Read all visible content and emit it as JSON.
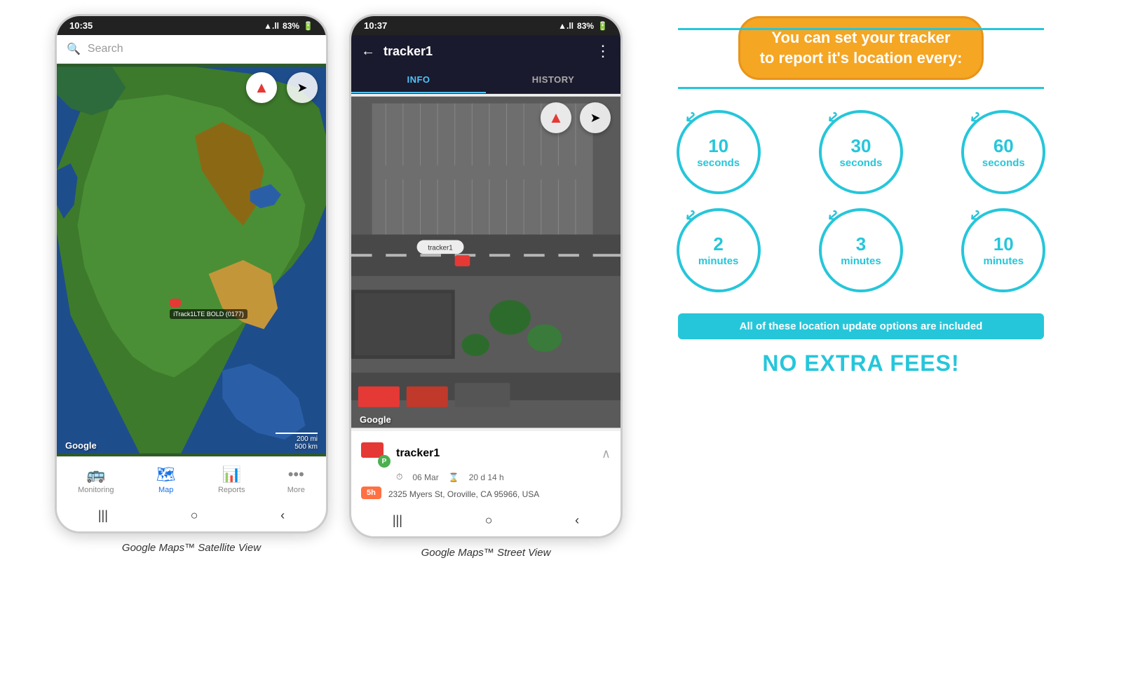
{
  "phone1": {
    "status_time": "10:35",
    "status_signal": "▲.ll",
    "status_battery": "83%",
    "search_placeholder": "Search",
    "compass1_symbol": "↑",
    "compass2_symbol": "➤",
    "tracker_label": "iTrack1LTE BOLD (0177)",
    "google_logo": "Google",
    "map_scale1": "200 mi",
    "map_scale2": "500 km",
    "nav_items": [
      {
        "label": "Monitoring",
        "icon": "🚌",
        "active": false
      },
      {
        "label": "Map",
        "icon": "🗺",
        "active": true
      },
      {
        "label": "Reports",
        "icon": "📊",
        "active": false
      },
      {
        "label": "More",
        "icon": "•••",
        "active": false
      }
    ],
    "gesture_buttons": [
      "|||",
      "○",
      "<"
    ],
    "caption": "Google Maps™ Satellite View"
  },
  "phone2": {
    "status_time": "10:37",
    "status_signal": "▲.ll",
    "status_battery": "83%",
    "back_icon": "←",
    "title": "tracker1",
    "menu_icon": "⋮",
    "tab_info": "INFO",
    "tab_history": "HISTORY",
    "compass1_symbol": "↑",
    "compass2_symbol": "➤",
    "google_logo": "Google",
    "tracker_name": "tracker1",
    "tracker_name_label": "tracker1",
    "tracker_p_label": "P",
    "time_badge": "5h",
    "date_meta": "06 Mar",
    "duration_meta": "20 d 14 h",
    "address": "2325 Myers St, Oroville, CA 95966, USA",
    "aerial_label": "tracker1",
    "gesture_buttons": [
      "|||",
      "○",
      "<"
    ],
    "caption": "Google Maps™ Street View"
  },
  "infographic": {
    "headline": "You can set your tracker\nto report it's location every:",
    "teal_color": "#26c6da",
    "orange_color": "#f5a623",
    "circles": [
      {
        "number": "10",
        "unit": "seconds"
      },
      {
        "number": "30",
        "unit": "seconds"
      },
      {
        "number": "60",
        "unit": "seconds"
      },
      {
        "number": "2",
        "unit": "minutes"
      },
      {
        "number": "3",
        "unit": "minutes"
      },
      {
        "number": "10",
        "unit": "minutes"
      }
    ],
    "banner_text": "All of these location update options are included",
    "no_fees_text": "NO EXTRA FEES!"
  }
}
